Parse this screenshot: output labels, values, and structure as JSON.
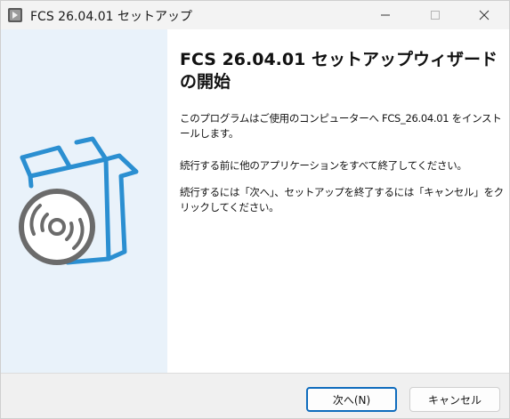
{
  "window": {
    "title": "FCS 26.04.01 セットアップ",
    "controls": [
      "minimize",
      "maximize",
      "close"
    ]
  },
  "banner": {
    "icon": "software-box-with-disc-icon",
    "accent_color": "#2b8fd1",
    "disc_color": "#6b6b6b"
  },
  "main": {
    "heading": "FCS 26.04.01 セットアップウィザードの開始",
    "paragraphs": [
      "このプログラムはご使用のコンピューターへ FCS_26.04.01 をインストールします。",
      "続行する前に他のアプリケーションをすべて終了してください。",
      "続行するには「次へ」、セットアップを終了するには「キャンセル」をクリックしてください。"
    ]
  },
  "footer": {
    "next_label": "次へ(N)",
    "cancel_label": "キャンセル",
    "primary_color": "#0f6cbd"
  }
}
